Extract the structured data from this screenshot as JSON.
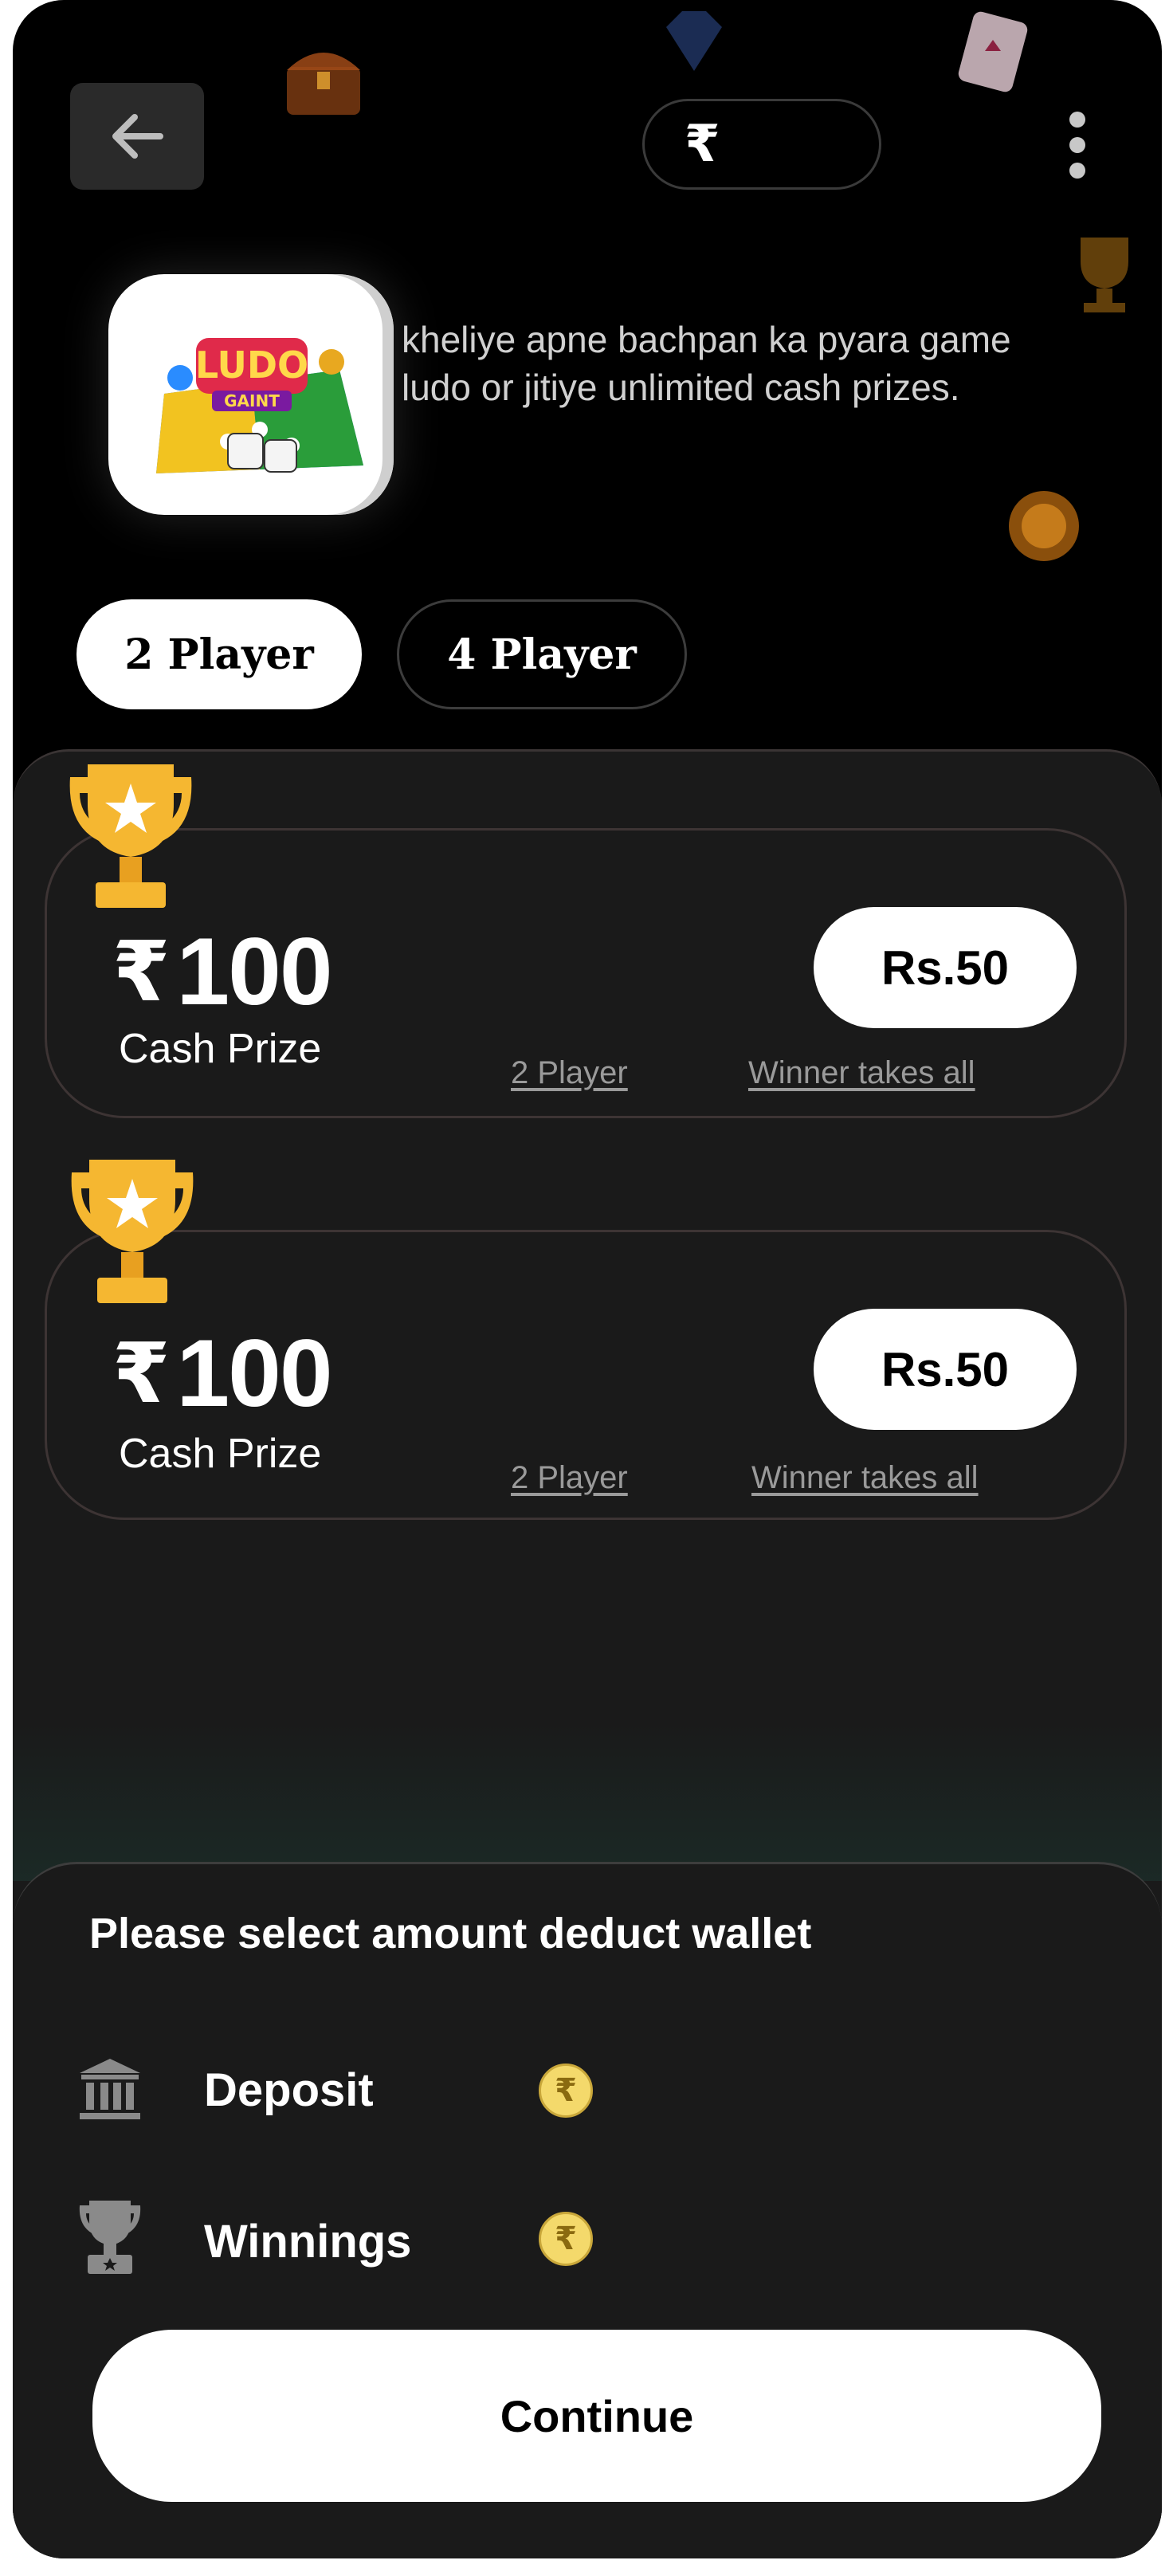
{
  "header": {
    "back_icon": "arrow-left-icon",
    "wallet_currency": "₹",
    "wallet_balance": "",
    "menu_icon": "more-vertical-icon"
  },
  "game": {
    "logo_text_top": "LUDO",
    "logo_text_bottom": "GAINT",
    "description": "kheliye apne bachpan ka pyara game ludo or jitiye unlimited cash prizes."
  },
  "tabs": [
    {
      "label": "2 Player",
      "active": true
    },
    {
      "label": "4 Player",
      "active": false
    }
  ],
  "contests": [
    {
      "currency": "₹",
      "prize": "100",
      "prize_label": "Cash Prize",
      "entry": "Rs.50",
      "players": "2 Player",
      "type": "Winner takes all"
    },
    {
      "currency": "₹",
      "prize": "100",
      "prize_label": "Cash Prize",
      "entry": "Rs.50",
      "players": "2 Player",
      "type": "Winner takes all"
    }
  ],
  "wallet_sheet": {
    "title": "Please select amount deduct wallet",
    "options": [
      {
        "label": "Deposit",
        "icon": "bank-icon",
        "coin": "₹"
      },
      {
        "label": "Winnings",
        "icon": "trophy-icon",
        "coin": "₹"
      }
    ],
    "continue_label": "Continue"
  },
  "colors": {
    "background": "#000000",
    "panel": "#1a1a1a",
    "trophy": "#f5b731",
    "coin": "#f4d96b"
  }
}
